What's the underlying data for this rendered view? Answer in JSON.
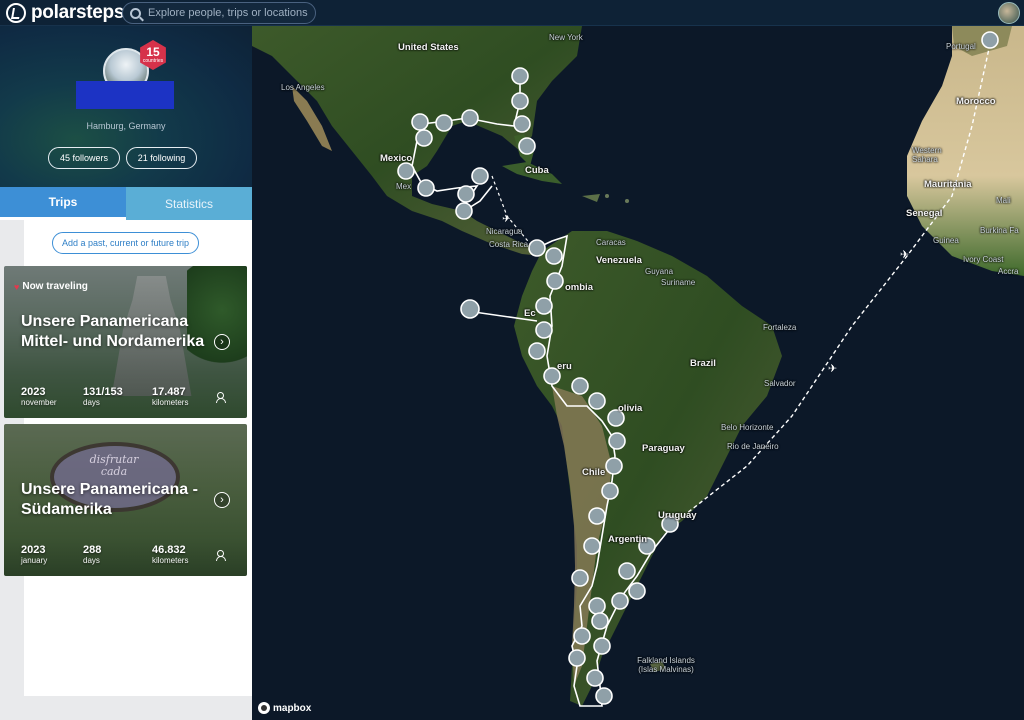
{
  "app": {
    "brand": "polarsteps",
    "search_placeholder": "Explore people, trips or locations..."
  },
  "profile": {
    "countries_count": "15",
    "countries_label": "countries",
    "location": "Hamburg, Germany",
    "followers_label": "45 followers",
    "following_label": "21 following"
  },
  "tabs": [
    {
      "label": "Trips",
      "active": true
    },
    {
      "label": "Statistics",
      "active": false
    }
  ],
  "add_trip_label": "Add a past, current or future trip",
  "trips": [
    {
      "badge": "Now traveling",
      "title": "Unsere Panamericana Mittel- und Nordamerika",
      "stats": [
        {
          "value": "2023",
          "label": "november"
        },
        {
          "value": "131/153",
          "label": "days"
        },
        {
          "value": "17.487",
          "label": "kilometers"
        }
      ]
    },
    {
      "badge": "",
      "title": "Unsere Panamericana - Südamerika",
      "stats": [
        {
          "value": "2023",
          "label": "january"
        },
        {
          "value": "288",
          "label": "days"
        },
        {
          "value": "46.832",
          "label": "kilometers"
        }
      ]
    }
  ],
  "map": {
    "attribution": "mapbox",
    "labels": {
      "united_states": "United States",
      "new_york": "New York",
      "los_angeles": "Los Angeles",
      "mexico": "Mexico",
      "mexico_city": "Mex",
      "cuba": "Cuba",
      "nicaragua": "Nicaragua",
      "costa_rica": "Costa Rica",
      "caracas": "Caracas",
      "venezuela": "Venezuela",
      "colombia": "ombia",
      "guyana": "Guyana",
      "suriname": "Suriname",
      "ecuador": "Ec",
      "peru": "eru",
      "brazil": "Brazil",
      "fortaleza": "Fortaleza",
      "salvador": "Salvador",
      "bolivia": "olivia",
      "belo_horizonte": "Belo Horizonte",
      "rio": "Rio de Janeiro",
      "paraguay": "Paraguay",
      "chile": "Chile",
      "uruguay": "Uruguay",
      "argentina": "Argentin",
      "falkland": "Falkland Islands (Islas Malvinas)",
      "portugal": "Portugal",
      "morocco": "Morocco",
      "western_sahara": "Western Sahara",
      "mauritania": "Mauritania",
      "mali": "Mali",
      "senegal": "Senegal",
      "guinea": "Guinea",
      "burkina": "Burkina Fa",
      "ivory_coast": "Ivory Coast",
      "accra": "Accra"
    }
  }
}
